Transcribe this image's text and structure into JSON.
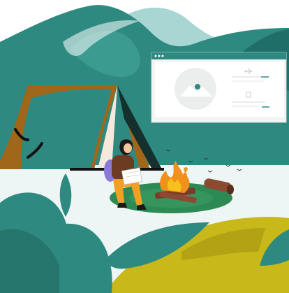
{
  "scene": {
    "colors": {
      "mountain_back": "#a8d6d2",
      "mountain_front": "#2e8a80",
      "teal_dark": "#1f6f68",
      "tent_brown": "#a0661a",
      "tent_teal": "#2e8a80",
      "ground": "#eef6f5",
      "grass_ring": "#2d8a55",
      "fire_orange": "#f0901d",
      "fire_yellow": "#f7c11b",
      "log_brown": "#7a3b28",
      "hill_yellow": "#c9b81a",
      "person_shirt": "#6b3b22",
      "person_pants": "#f2a023",
      "backpack": "#8a7ad6",
      "browser_bar": "#2e8a80"
    },
    "browser": {
      "icons": [
        "image-placeholder-icon",
        "airplane-icon",
        "trash-icon"
      ]
    }
  }
}
